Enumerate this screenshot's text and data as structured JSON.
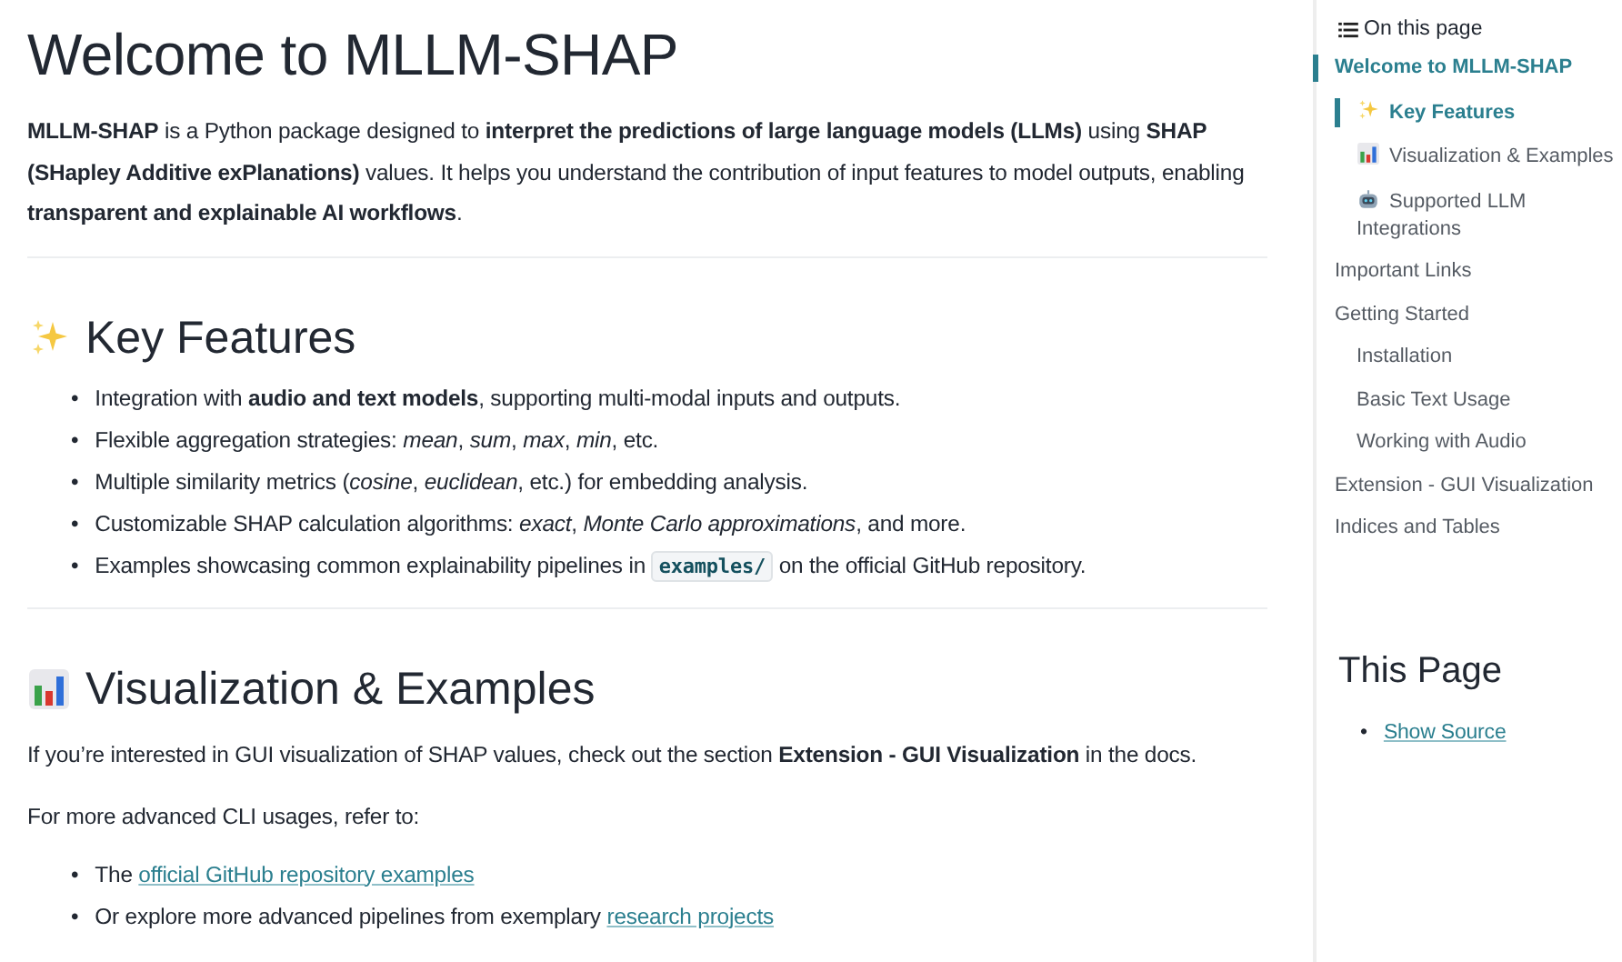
{
  "title": "Welcome to MLLM-SHAP",
  "intro": "**MLLM-SHAP** is a Python package designed to **interpret the predictions of large language models (LLMs)** using **SHAP (SHapley Additive exPlanations)** values. It helps you understand the contribution of input features to model outputs, enabling **transparent and explainable AI workflows**.",
  "sections": [
    {
      "heading": "Key Features",
      "blocks": [
        {
          "kind": "list",
          "items": [
            {
              "bullet": "•",
              "parts": [
                {
                  "kind": "text",
                  "text": "Integration with **audio and text models**, supporting multi-modal inputs and outputs."
                }
              ]
            },
            {
              "bullet": "•",
              "parts": [
                {
                  "kind": "text",
                  "text": "Flexible aggregation strategies: *mean*, *sum*, *max*, *min*, etc."
                }
              ]
            },
            {
              "bullet": "•",
              "parts": [
                {
                  "kind": "text",
                  "text": "Multiple similarity metrics (*cosine*, *euclidean*, etc.) for embedding analysis."
                }
              ]
            },
            {
              "bullet": "•",
              "parts": [
                {
                  "kind": "text",
                  "text": "Customizable SHAP calculation algorithms: *exact*, *Monte Carlo approximations*, and more."
                }
              ]
            },
            {
              "bullet": "•",
              "parts": [
                {
                  "kind": "text",
                  "text": "Examples showcasing common explainability pipelines in"
                },
                {
                  "kind": "code",
                  "text": "examples/"
                },
                {
                  "kind": "text",
                  "text": "on the official GitHub repository."
                }
              ]
            }
          ]
        }
      ]
    },
    {
      "heading": "Visualization & Examples",
      "blocks": [
        {
          "kind": "para",
          "text": "If you’re interested in GUI visualization of SHAP values, check out the section **Extension - GUI Visualization** in the docs."
        },
        {
          "kind": "para",
          "text": "For more advanced CLI usages, refer to:"
        },
        {
          "kind": "list",
          "items": [
            {
              "bullet": "•",
              "parts": [
                {
                  "kind": "text",
                  "text": "The"
                },
                {
                  "kind": "link",
                  "text": "official GitHub repository examples"
                }
              ]
            },
            {
              "bullet": "•",
              "parts": [
                {
                  "kind": "text",
                  "text": "Or explore more advanced pipelines from exemplary"
                },
                {
                  "kind": "link",
                  "text": "research projects"
                }
              ]
            }
          ]
        }
      ]
    }
  ],
  "toc": {
    "title": "On this page",
    "items": [
      {
        "label": "Welcome to MLLM-SHAP",
        "selected": true,
        "children": [
          {
            "label": "Key Features",
            "selected": true
          },
          {
            "label": "Visualization & Examples",
            "selected": false
          },
          {
            "label": "Supported LLM Integrations",
            "selected": false
          }
        ]
      },
      {
        "label": "Important Links",
        "selected": false
      },
      {
        "label": "Getting Started",
        "selected": false,
        "children": [
          {
            "label": "Installation",
            "selected": false
          },
          {
            "label": "Basic Text Usage",
            "selected": false
          },
          {
            "label": "Working with Audio",
            "selected": false
          }
        ]
      },
      {
        "label": "Extension - GUI Visualization",
        "selected": false
      },
      {
        "label": "Indices and Tables",
        "selected": false
      }
    ]
  },
  "this_page": {
    "title": "This Page",
    "links": [
      {
        "bullet": "•",
        "label": "Show Source"
      }
    ]
  }
}
